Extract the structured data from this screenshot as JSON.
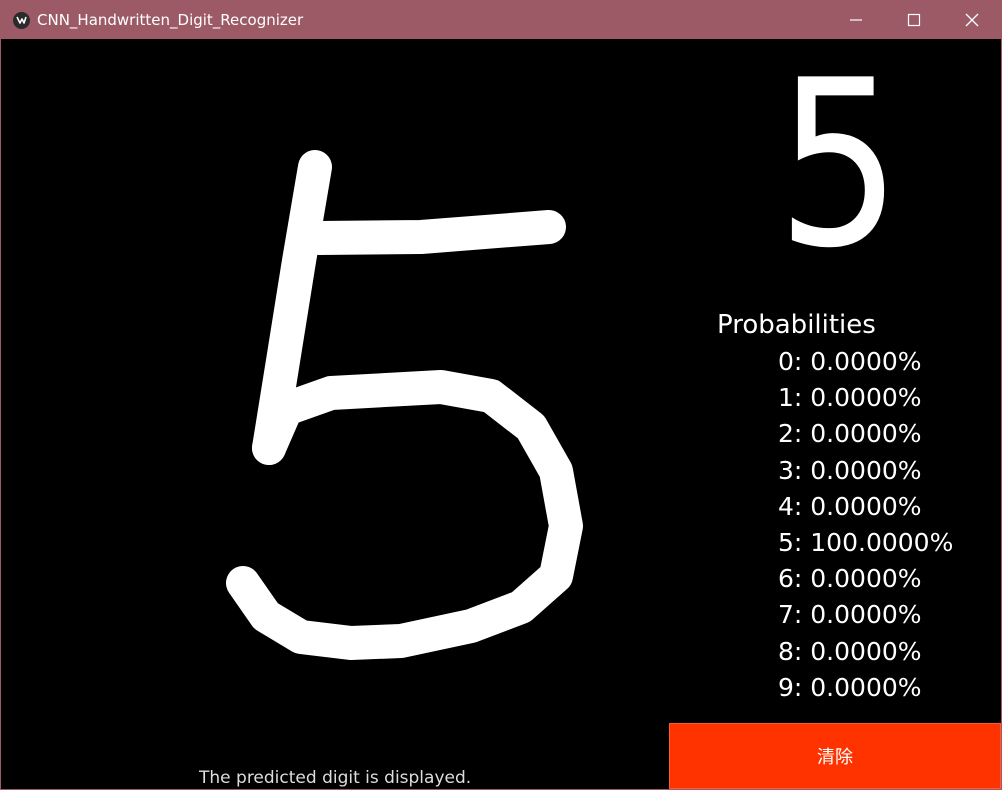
{
  "window": {
    "title": "CNN_Handwritten_Digit_Recognizer"
  },
  "prediction": {
    "digit": "5"
  },
  "probabilities": {
    "title": "Probabilities",
    "rows": [
      "0: 0.0000%",
      "1: 0.0000%",
      "2: 0.0000%",
      "3: 0.0000%",
      "4: 0.0000%",
      "5: 100.0000%",
      "6: 0.0000%",
      "7: 0.0000%",
      "8: 0.0000%",
      "9: 0.0000%"
    ]
  },
  "controls": {
    "clear_label": "清除"
  },
  "status": {
    "text": "The predicted digit is displayed."
  },
  "colors": {
    "titlebar": "#9c5a66",
    "background": "#000000",
    "clear_button": "#ff3300",
    "ink": "#ffffff"
  },
  "icons": {
    "app": "kivy-logo-icon",
    "minimize": "minimize-icon",
    "maximize": "maximize-icon",
    "close": "close-icon"
  }
}
